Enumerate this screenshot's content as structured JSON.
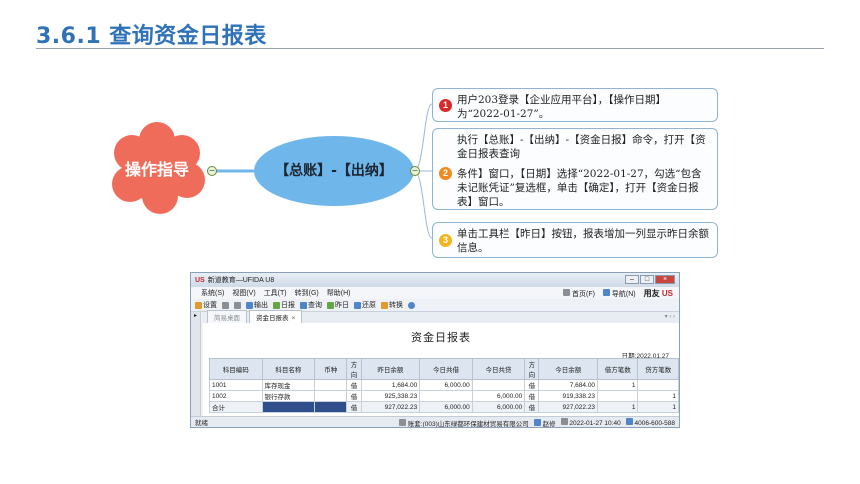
{
  "slide": {
    "title": "3.6.1 查询资金日报表"
  },
  "mindmap": {
    "root": "操作指导",
    "node": "【总账】-【出纳】",
    "steps": [
      {
        "num": "1",
        "text": "用户203登录【企业应用平台】，【操作日期】为“2022-01-27”。"
      },
      {
        "num": "2",
        "text": "执行【总账】-【出纳】-【资金日报】命令，打开【资金日报表查询",
        "text2": "条件】窗口，【日期】选择“2022-01-27，勾选“包含未记账凭证”复选框，单击【确定】，打开【资金日报表】窗口。"
      },
      {
        "num": "3",
        "text": "单击工具栏【昨日】按钮，报表增加一列显示昨日余额信息。"
      }
    ]
  },
  "app": {
    "window_title": "新道教育—UFIDA U8",
    "menu": [
      "系统(S)",
      "视图(V)",
      "工具(T)",
      "转到(G)",
      "帮助(H)"
    ],
    "menu_right": {
      "home": "首页(F)",
      "nav": "导航(N)",
      "brand": "用友"
    },
    "toolbar": [
      "设置",
      "",
      "",
      "输出",
      "日报",
      "查询",
      "昨日",
      "还原",
      "转换",
      ""
    ],
    "tabs": [
      {
        "label": "简易桌面"
      },
      {
        "label": "资金日报表"
      }
    ],
    "report": {
      "title": "资金日报表",
      "date_label": "日期:2022.01.27",
      "columns": [
        "科目编码",
        "科目名称",
        "币种",
        "方向",
        "昨日余额",
        "今日共借",
        "今日共贷",
        "方向",
        "今日余额",
        "借方笔数",
        "贷方笔数"
      ],
      "rows": [
        [
          "1001",
          "库存现金",
          "",
          "借",
          "1,684.00",
          "6,000.00",
          "",
          "借",
          "7,684.00",
          "1",
          ""
        ],
        [
          "1002",
          "银行存款",
          "",
          "借",
          "925,338.23",
          "",
          "6,000.00",
          "借",
          "919,338.23",
          "",
          "1"
        ],
        [
          "合计",
          "",
          "",
          "借",
          "927,022.23",
          "6,000.00",
          "6,000.00",
          "借",
          "927,022.23",
          "1",
          "1"
        ]
      ]
    },
    "status": {
      "left": "就绪",
      "account": "账套:(003)山东绿都环保建材贸易有限公司",
      "user": "赵修",
      "datetime": "2022-01-27 10:40",
      "phone": "4006-600-588"
    }
  },
  "colors": {
    "title": "#2f72b8",
    "cloud": "#f06c5a",
    "ellipse": "#6fb7ea"
  }
}
